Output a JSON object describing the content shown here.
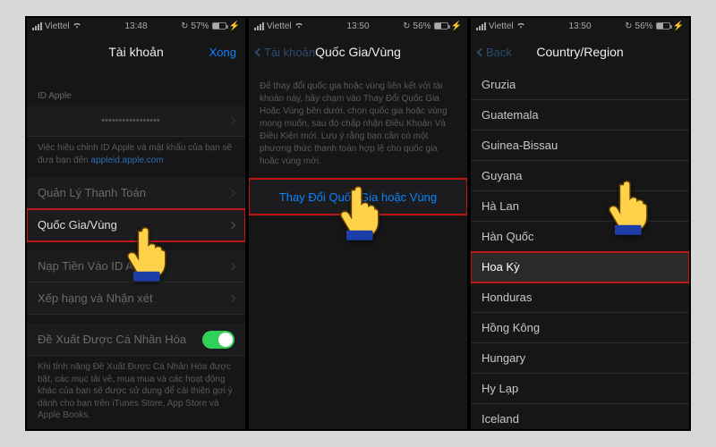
{
  "statusbar": {
    "carrier": "Viettel",
    "wifi_icon": "wifi",
    "battery_pct1": "57%",
    "battery_pct2": "56%",
    "battery_pct3": "56%",
    "time1": "13:48",
    "time2": "13:50",
    "time3": "13:50",
    "lock": "lock",
    "charging": "⚡"
  },
  "screen1": {
    "nav_title": "Tài khoản",
    "nav_done": "Xong",
    "section_id_label": "ID Apple",
    "apple_id_value": "•••••••••••••••••",
    "id_help_prefix": "Việc hiệu chỉnh ID Apple và mật khẩu của bạn sẽ đưa bạn đến ",
    "id_help_link": "appleid.apple.com",
    "row_payment": "Quản Lý Thanh Toán",
    "row_country": "Quốc Gia/Vùng",
    "row_fund": "Nạp Tiền Vào ID Apple",
    "row_rate": "Xếp hạng và Nhận xét",
    "row_personal": "Đề Xuất Được Cá Nhân Hóa",
    "personal_desc": "Khi tính năng Đề Xuất Được Cá Nhân Hóa được bật, các mục tải về, mua mua và các hoạt động khác của bạn sẽ được sử dụng để cải thiện gợi ý dành cho bạn trên iTunes Store, App Store và Apple Books."
  },
  "screen2": {
    "nav_back": "Tài khoản",
    "nav_title": "Quốc Gia/Vùng",
    "info": "Để thay đổi quốc gia hoặc vùng liên kết với tài khoản này, hãy chạm vào Thay Đổi Quốc Gia Hoặc Vùng bên dưới, chọn quốc gia hoặc vùng mong muốn, sau đó chấp nhận Điều Khoản Và Điều Kiện mới. Lưu ý rằng bạn cần có một phương thức thanh toán hợp lệ cho quốc gia hoặc vùng mới.",
    "change_btn": "Thay Đổi Quốc Gia hoặc Vùng"
  },
  "screen3": {
    "nav_back": "Back",
    "nav_title": "Country/Region",
    "countries": [
      "Gruzia",
      "Guatemala",
      "Guinea-Bissau",
      "Guyana",
      "Hà Lan",
      "Hàn Quốc",
      "Hoa Kỳ",
      "Honduras",
      "Hồng Kông",
      "Hungary",
      "Hy Lạp",
      "Iceland"
    ],
    "selected_index": 6
  }
}
